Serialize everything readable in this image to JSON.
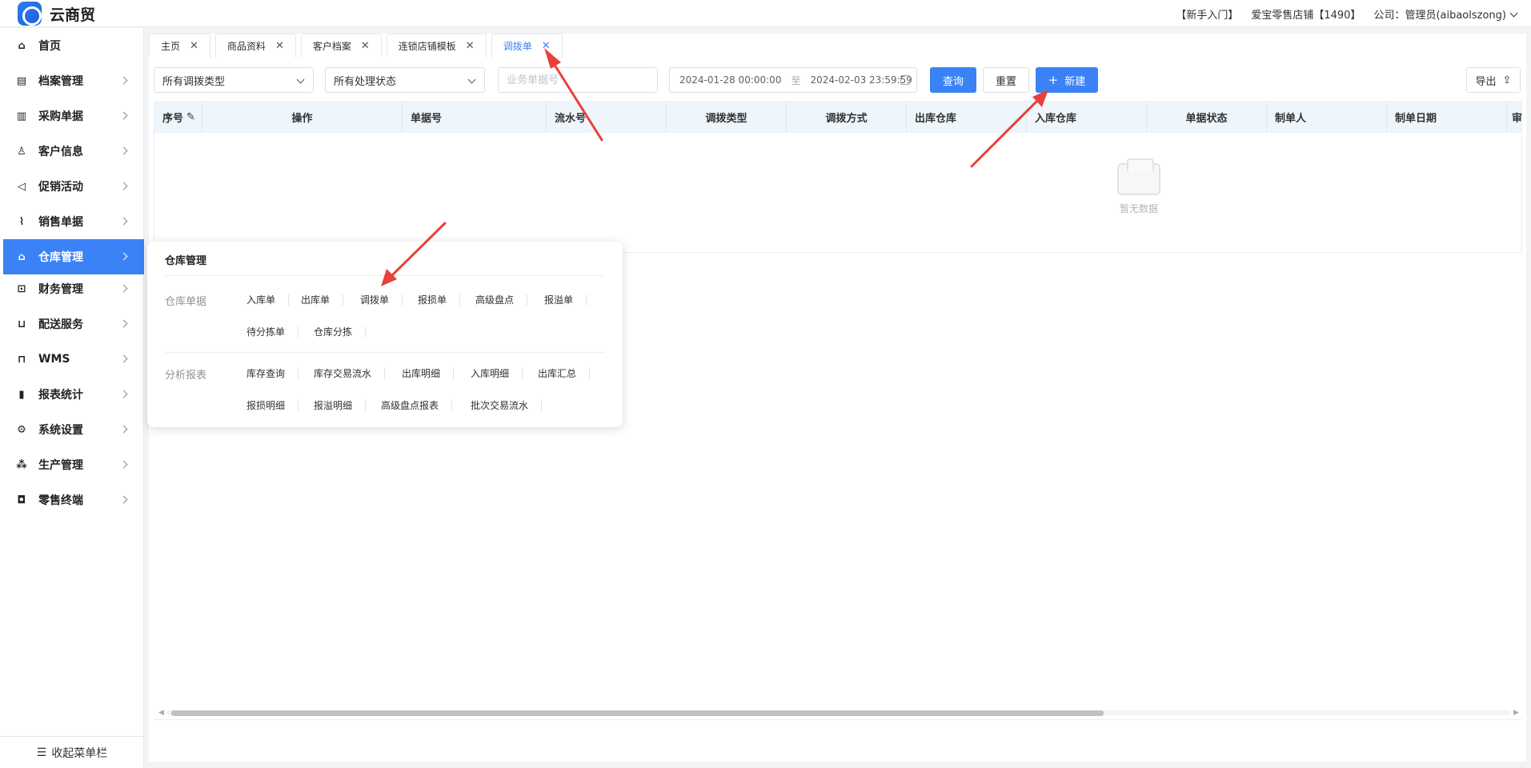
{
  "app": {
    "title": "云商贸"
  },
  "header": {
    "guide": "【新手入门】",
    "store": "爱宝零售店铺【1490】",
    "company": "公司：管理员(aibaolszong)"
  },
  "sidebar": {
    "items": [
      {
        "label": "首页",
        "icon": "home-icon",
        "glyph": "⌂"
      },
      {
        "label": "档案管理",
        "icon": "archive-icon",
        "glyph": "▤"
      },
      {
        "label": "采购单据",
        "icon": "document-icon",
        "glyph": "▥"
      },
      {
        "label": "客户信息",
        "icon": "user-icon",
        "glyph": "♙"
      },
      {
        "label": "促销活动",
        "icon": "megaphone-icon",
        "glyph": "◁"
      },
      {
        "label": "销售单据",
        "icon": "chart-line-icon",
        "glyph": "⌇"
      },
      {
        "label": "仓库管理",
        "icon": "warehouse-icon",
        "glyph": "⌂"
      },
      {
        "label": "财务管理",
        "icon": "finance-icon",
        "glyph": "⊡"
      },
      {
        "label": "配送服务",
        "icon": "cart-icon",
        "glyph": "⊔"
      },
      {
        "label": "WMS",
        "icon": "truck-icon",
        "glyph": "⊓"
      },
      {
        "label": "报表统计",
        "icon": "bar-chart-icon",
        "glyph": "▮"
      },
      {
        "label": "系统设置",
        "icon": "gear-icon",
        "glyph": "⚙"
      },
      {
        "label": "生产管理",
        "icon": "network-icon",
        "glyph": "⁂"
      },
      {
        "label": "零售终端",
        "icon": "bag-icon",
        "glyph": "◘"
      }
    ],
    "active_index": 6,
    "collapse_label": "收起菜单栏"
  },
  "tabs": [
    {
      "label": "主页",
      "active": false
    },
    {
      "label": "商品资料",
      "active": false
    },
    {
      "label": "客户档案",
      "active": false
    },
    {
      "label": "连锁店铺模板",
      "active": false
    },
    {
      "label": "调拨单",
      "active": true
    }
  ],
  "filters": {
    "type_select": "所有调拨类型",
    "status_select": "所有处理状态",
    "bill_placeholder": "业务单据号",
    "date_start": "2024-01-28 00:00:00",
    "date_sep": "至",
    "date_end": "2024-02-03 23:59:59",
    "query_label": "查询",
    "reset_label": "重置",
    "new_label": "新建",
    "export_label": "导出"
  },
  "table": {
    "columns": [
      "序号",
      "操作",
      "单据号",
      "流水号",
      "调拨类型",
      "调拨方式",
      "出库仓库",
      "入库仓库",
      "单据状态",
      "制单人",
      "制单日期",
      "审"
    ],
    "empty_text": "暂无数据"
  },
  "popup": {
    "title": "仓库管理",
    "groups": [
      {
        "label": "仓库单据",
        "items": [
          "入库单",
          "出库单",
          "调拨单",
          "报损单",
          "高级盘点",
          "报溢单",
          "待分拣单",
          "仓库分拣"
        ]
      },
      {
        "label": "分析报表",
        "items": [
          "库存查询",
          "库存交易流水",
          "出库明细",
          "入库明细",
          "出库汇总",
          "报损明细",
          "报溢明细",
          "高级盘点报表",
          "批次交易流水"
        ]
      }
    ]
  },
  "colors": {
    "accent": "#3b82f6",
    "arrow": "#e8413b"
  }
}
